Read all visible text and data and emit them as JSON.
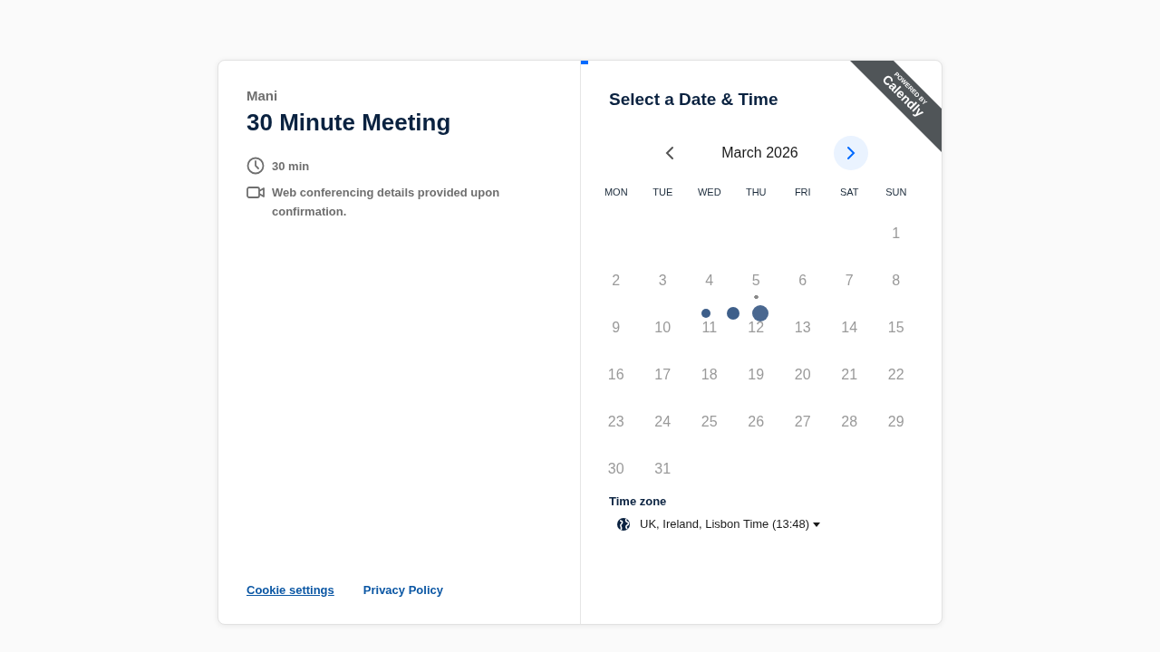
{
  "host": "Mani",
  "event_title": "30 Minute Meeting",
  "details": [
    {
      "kind": "duration",
      "text": "30 min"
    },
    {
      "kind": "video",
      "text": "Web conferencing details provided upon confirmation."
    }
  ],
  "footer_links": [
    {
      "text": "Cookie settings",
      "underlined": true
    },
    {
      "text": "Privacy Policy",
      "underlined": false
    }
  ],
  "loading_bar": {
    "level": 0.02
  },
  "badge": {
    "top": "POWERED BY",
    "brand": "Calendly"
  },
  "heading": "Select a Date & Time",
  "calendar": {
    "month": "March 2026",
    "prev_enabled": false,
    "next_enabled": true,
    "loading": true,
    "weekdays": [
      "MON",
      "TUE",
      "WED",
      "THU",
      "FRI",
      "SAT",
      "SUN"
    ],
    "weeks": [
      {
        "days": [
          {
            "kind": "blank"
          },
          {
            "kind": "blank"
          },
          {
            "kind": "blank"
          },
          {
            "kind": "blank"
          },
          {
            "kind": "blank"
          },
          {
            "kind": "blank"
          },
          {
            "kind": "day",
            "label": "1",
            "today": false
          }
        ]
      },
      {
        "days": [
          {
            "kind": "day",
            "label": "2",
            "today": false
          },
          {
            "kind": "day",
            "label": "3",
            "today": false
          },
          {
            "kind": "day",
            "label": "4",
            "today": false
          },
          {
            "kind": "day",
            "label": "5",
            "today": true
          },
          {
            "kind": "day",
            "label": "6",
            "today": false
          },
          {
            "kind": "day",
            "label": "7",
            "today": false
          },
          {
            "kind": "day",
            "label": "8",
            "today": false
          }
        ]
      },
      {
        "days": [
          {
            "kind": "day",
            "label": "9",
            "today": false
          },
          {
            "kind": "day",
            "label": "10",
            "today": false
          },
          {
            "kind": "day",
            "label": "11",
            "today": false
          },
          {
            "kind": "day",
            "label": "12",
            "today": false
          },
          {
            "kind": "day",
            "label": "13",
            "today": false
          },
          {
            "kind": "day",
            "label": "14",
            "today": false
          },
          {
            "kind": "day",
            "label": "15",
            "today": false
          }
        ]
      },
      {
        "days": [
          {
            "kind": "day",
            "label": "16",
            "today": false
          },
          {
            "kind": "day",
            "label": "17",
            "today": false
          },
          {
            "kind": "day",
            "label": "18",
            "today": false
          },
          {
            "kind": "day",
            "label": "19",
            "today": false
          },
          {
            "kind": "day",
            "label": "20",
            "today": false
          },
          {
            "kind": "day",
            "label": "21",
            "today": false
          },
          {
            "kind": "day",
            "label": "22",
            "today": false
          }
        ]
      },
      {
        "days": [
          {
            "kind": "day",
            "label": "23",
            "today": false
          },
          {
            "kind": "day",
            "label": "24",
            "today": false
          },
          {
            "kind": "day",
            "label": "25",
            "today": false
          },
          {
            "kind": "day",
            "label": "26",
            "today": false
          },
          {
            "kind": "day",
            "label": "27",
            "today": false
          },
          {
            "kind": "day",
            "label": "28",
            "today": false
          },
          {
            "kind": "day",
            "label": "29",
            "today": false
          }
        ]
      },
      {
        "days": [
          {
            "kind": "day",
            "label": "30",
            "today": false
          },
          {
            "kind": "day",
            "label": "31",
            "today": false
          },
          {
            "kind": "blank"
          },
          {
            "kind": "blank"
          },
          {
            "kind": "blank"
          },
          {
            "kind": "blank"
          },
          {
            "kind": "blank"
          }
        ]
      }
    ]
  },
  "timezone": {
    "label": "Time zone",
    "value": "UK, Ireland, Lisbon Time (13:48)"
  }
}
